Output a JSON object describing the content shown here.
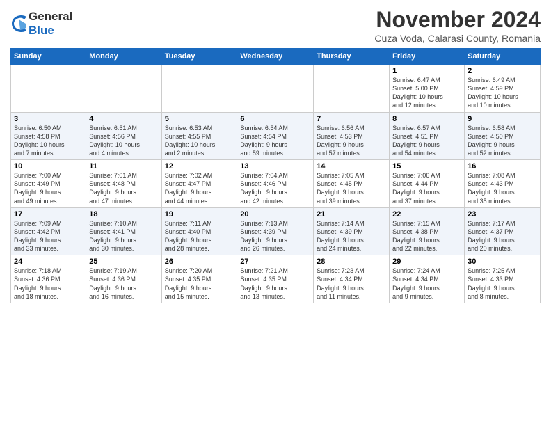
{
  "header": {
    "logo_general": "General",
    "logo_blue": "Blue",
    "main_title": "November 2024",
    "subtitle": "Cuza Voda, Calarasi County, Romania"
  },
  "weekdays": [
    "Sunday",
    "Monday",
    "Tuesday",
    "Wednesday",
    "Thursday",
    "Friday",
    "Saturday"
  ],
  "rows": [
    {
      "cells": [
        {
          "day": "",
          "info": ""
        },
        {
          "day": "",
          "info": ""
        },
        {
          "day": "",
          "info": ""
        },
        {
          "day": "",
          "info": ""
        },
        {
          "day": "",
          "info": ""
        },
        {
          "day": "1",
          "info": "Sunrise: 6:47 AM\nSunset: 5:00 PM\nDaylight: 10 hours\nand 12 minutes."
        },
        {
          "day": "2",
          "info": "Sunrise: 6:49 AM\nSunset: 4:59 PM\nDaylight: 10 hours\nand 10 minutes."
        }
      ]
    },
    {
      "cells": [
        {
          "day": "3",
          "info": "Sunrise: 6:50 AM\nSunset: 4:58 PM\nDaylight: 10 hours\nand 7 minutes."
        },
        {
          "day": "4",
          "info": "Sunrise: 6:51 AM\nSunset: 4:56 PM\nDaylight: 10 hours\nand 4 minutes."
        },
        {
          "day": "5",
          "info": "Sunrise: 6:53 AM\nSunset: 4:55 PM\nDaylight: 10 hours\nand 2 minutes."
        },
        {
          "day": "6",
          "info": "Sunrise: 6:54 AM\nSunset: 4:54 PM\nDaylight: 9 hours\nand 59 minutes."
        },
        {
          "day": "7",
          "info": "Sunrise: 6:56 AM\nSunset: 4:53 PM\nDaylight: 9 hours\nand 57 minutes."
        },
        {
          "day": "8",
          "info": "Sunrise: 6:57 AM\nSunset: 4:51 PM\nDaylight: 9 hours\nand 54 minutes."
        },
        {
          "day": "9",
          "info": "Sunrise: 6:58 AM\nSunset: 4:50 PM\nDaylight: 9 hours\nand 52 minutes."
        }
      ]
    },
    {
      "cells": [
        {
          "day": "10",
          "info": "Sunrise: 7:00 AM\nSunset: 4:49 PM\nDaylight: 9 hours\nand 49 minutes."
        },
        {
          "day": "11",
          "info": "Sunrise: 7:01 AM\nSunset: 4:48 PM\nDaylight: 9 hours\nand 47 minutes."
        },
        {
          "day": "12",
          "info": "Sunrise: 7:02 AM\nSunset: 4:47 PM\nDaylight: 9 hours\nand 44 minutes."
        },
        {
          "day": "13",
          "info": "Sunrise: 7:04 AM\nSunset: 4:46 PM\nDaylight: 9 hours\nand 42 minutes."
        },
        {
          "day": "14",
          "info": "Sunrise: 7:05 AM\nSunset: 4:45 PM\nDaylight: 9 hours\nand 39 minutes."
        },
        {
          "day": "15",
          "info": "Sunrise: 7:06 AM\nSunset: 4:44 PM\nDaylight: 9 hours\nand 37 minutes."
        },
        {
          "day": "16",
          "info": "Sunrise: 7:08 AM\nSunset: 4:43 PM\nDaylight: 9 hours\nand 35 minutes."
        }
      ]
    },
    {
      "cells": [
        {
          "day": "17",
          "info": "Sunrise: 7:09 AM\nSunset: 4:42 PM\nDaylight: 9 hours\nand 33 minutes."
        },
        {
          "day": "18",
          "info": "Sunrise: 7:10 AM\nSunset: 4:41 PM\nDaylight: 9 hours\nand 30 minutes."
        },
        {
          "day": "19",
          "info": "Sunrise: 7:11 AM\nSunset: 4:40 PM\nDaylight: 9 hours\nand 28 minutes."
        },
        {
          "day": "20",
          "info": "Sunrise: 7:13 AM\nSunset: 4:39 PM\nDaylight: 9 hours\nand 26 minutes."
        },
        {
          "day": "21",
          "info": "Sunrise: 7:14 AM\nSunset: 4:39 PM\nDaylight: 9 hours\nand 24 minutes."
        },
        {
          "day": "22",
          "info": "Sunrise: 7:15 AM\nSunset: 4:38 PM\nDaylight: 9 hours\nand 22 minutes."
        },
        {
          "day": "23",
          "info": "Sunrise: 7:17 AM\nSunset: 4:37 PM\nDaylight: 9 hours\nand 20 minutes."
        }
      ]
    },
    {
      "cells": [
        {
          "day": "24",
          "info": "Sunrise: 7:18 AM\nSunset: 4:36 PM\nDaylight: 9 hours\nand 18 minutes."
        },
        {
          "day": "25",
          "info": "Sunrise: 7:19 AM\nSunset: 4:36 PM\nDaylight: 9 hours\nand 16 minutes."
        },
        {
          "day": "26",
          "info": "Sunrise: 7:20 AM\nSunset: 4:35 PM\nDaylight: 9 hours\nand 15 minutes."
        },
        {
          "day": "27",
          "info": "Sunrise: 7:21 AM\nSunset: 4:35 PM\nDaylight: 9 hours\nand 13 minutes."
        },
        {
          "day": "28",
          "info": "Sunrise: 7:23 AM\nSunset: 4:34 PM\nDaylight: 9 hours\nand 11 minutes."
        },
        {
          "day": "29",
          "info": "Sunrise: 7:24 AM\nSunset: 4:34 PM\nDaylight: 9 hours\nand 9 minutes."
        },
        {
          "day": "30",
          "info": "Sunrise: 7:25 AM\nSunset: 4:33 PM\nDaylight: 9 hours\nand 8 minutes."
        }
      ]
    }
  ]
}
